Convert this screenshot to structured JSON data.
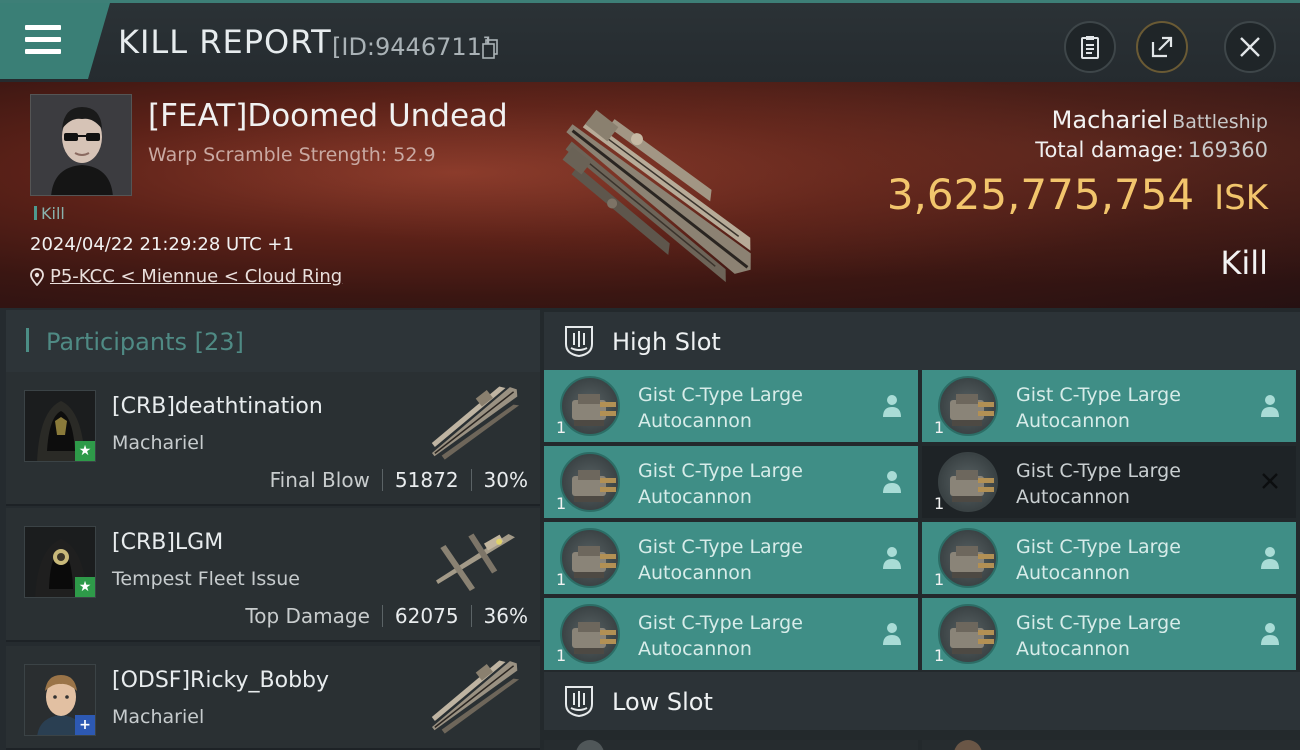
{
  "header": {
    "title": "KILL REPORT",
    "report_id": "[ID:9446711]"
  },
  "victim": {
    "name": "[FEAT]Doomed Undead",
    "warp_scramble": "Warp Scramble Strength: 52.9",
    "tag": "Kill",
    "timestamp": "2024/04/22 21:29:28 UTC +1",
    "location": "P5-KCC < Miennue < Cloud Ring",
    "ship": "Machariel",
    "ship_class": "Battleship",
    "total_damage_label": "Total damage:",
    "total_damage": "169360",
    "isk_value": "3,625,775,754",
    "isk_unit": "ISK",
    "result": "Kill"
  },
  "participants": {
    "title": "Participants",
    "count": "[23]",
    "items": [
      {
        "name": "[CRB]deathtination",
        "ship": "Machariel",
        "role": "Final Blow",
        "damage": "51872",
        "percent": "30%",
        "badge": "★"
      },
      {
        "name": "[CRB]LGM",
        "ship": "Tempest Fleet Issue",
        "role": "Top Damage",
        "damage": "62075",
        "percent": "36%",
        "badge": "★"
      },
      {
        "name": "[ODSF]Ricky_Bobby",
        "ship": "Machariel",
        "badge": "+"
      }
    ]
  },
  "slots": {
    "high_title": "High Slot",
    "low_title": "Low Slot",
    "modules": [
      {
        "line1": "Gist C-Type Large",
        "line2": "Autocannon",
        "qty": "1"
      },
      {
        "line1": "Gist C-Type Large",
        "line2": "Autocannon",
        "qty": "1"
      },
      {
        "line1": "Gist C-Type Large",
        "line2": "Autocannon",
        "qty": "1"
      },
      {
        "line1": "Gist C-Type Large",
        "line2": "Autocannon",
        "qty": "1"
      },
      {
        "line1": "Gist C-Type Large",
        "line2": "Autocannon",
        "qty": "1"
      },
      {
        "line1": "Gist C-Type Large",
        "line2": "Autocannon",
        "qty": "1"
      },
      {
        "line1": "Gist C-Type Large",
        "line2": "Autocannon",
        "qty": "1"
      },
      {
        "line1": "Gist C-Type Large",
        "line2": "Autocannon",
        "qty": "1"
      }
    ]
  },
  "colors": {
    "accent": "#3f8e86",
    "isk": "#f2c56c",
    "banner": "#5b2118"
  }
}
